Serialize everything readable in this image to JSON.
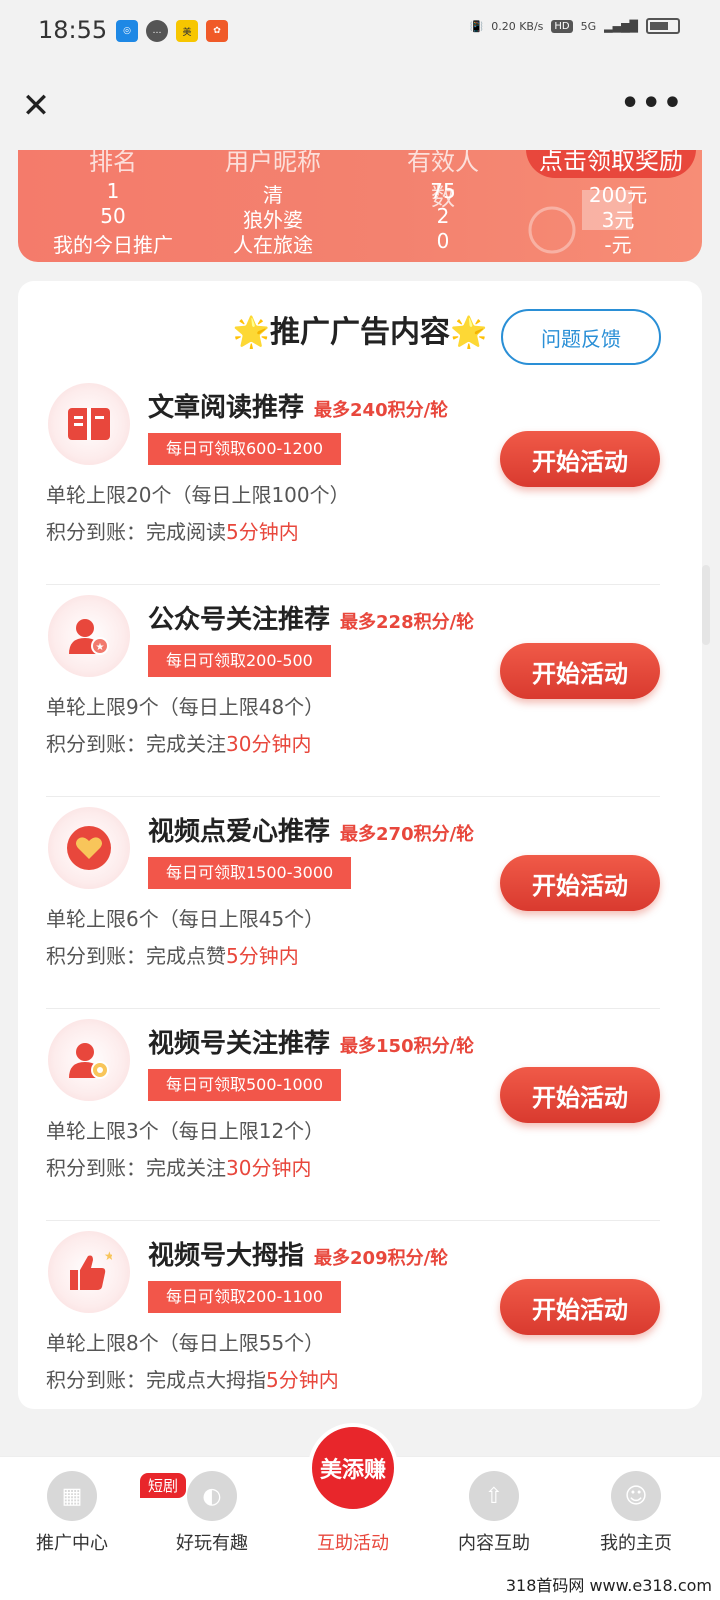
{
  "status": {
    "time": "18:55",
    "speed": "0.20 KB/s",
    "hd": "HD",
    "network": "5G"
  },
  "nav": {
    "close_glyph": "✕",
    "more_glyph": "•••"
  },
  "ranking": {
    "headers": [
      "排名",
      "用户昵称",
      "有效人数",
      "点击领取奖励"
    ],
    "rows": [
      {
        "rank": "1",
        "name": "清",
        "count": "75",
        "reward": "200元"
      },
      {
        "rank": "50",
        "name": "狼外婆",
        "count": "2",
        "reward": "3元"
      },
      {
        "rank": "我的今日推广",
        "name": "人在旅途",
        "count": "0",
        "reward": "-元"
      }
    ]
  },
  "section": {
    "title": "推广广告内容",
    "star": "🌟",
    "feedback_label": "问题反馈"
  },
  "tasks": [
    {
      "name": "文章阅读推荐",
      "max": "最多240积分/轮",
      "daily": "每日可领取600-1200",
      "limit": "单轮上限20个（每日上限100个）",
      "arrive_prefix": "积分到账：完成阅读",
      "arrive_time": "5分钟内",
      "button": "开始活动",
      "icon": "book-icon",
      "accent": "#e8473c"
    },
    {
      "name": "公众号关注推荐",
      "max": "最多228积分/轮",
      "daily": "每日可领取200-500",
      "limit": "单轮上限9个（每日上限48个）",
      "arrive_prefix": "积分到账：完成关注",
      "arrive_time": "30分钟内",
      "button": "开始活动",
      "icon": "user-star-icon",
      "accent": "#e8473c"
    },
    {
      "name": "视频点爱心推荐",
      "max": "最多270积分/轮",
      "daily": "每日可领取1500-3000",
      "limit": "单轮上限6个（每日上限45个）",
      "arrive_prefix": "积分到账：完成点赞",
      "arrive_time": "5分钟内",
      "button": "开始活动",
      "icon": "heart-icon",
      "accent": "#e8473c"
    },
    {
      "name": "视频号关注推荐",
      "max": "最多150积分/轮",
      "daily": "每日可领取500-1000",
      "limit": "单轮上限3个（每日上限12个）",
      "arrive_prefix": "积分到账：完成关注",
      "arrive_time": "30分钟内",
      "button": "开始活动",
      "icon": "user-follow-icon",
      "accent": "#e8473c"
    },
    {
      "name": "视频号大拇指",
      "max": "最多209积分/轮",
      "daily": "每日可领取200-1100",
      "limit": "单轮上限8个（每日上限55个）",
      "arrive_prefix": "积分到账：完成点大拇指",
      "arrive_time": "5分钟内",
      "button": "开始活动",
      "icon": "thumbs-up-icon",
      "accent": "#e8473c"
    }
  ],
  "tabbar": {
    "items": [
      {
        "label": "推广中心"
      },
      {
        "label": "好玩有趣",
        "badge": "短剧"
      },
      {
        "label": "互助活动",
        "logo": "美添赚"
      },
      {
        "label": "内容互助"
      },
      {
        "label": "我的主页"
      }
    ]
  },
  "watermark": "318首码网 www.e318.com"
}
